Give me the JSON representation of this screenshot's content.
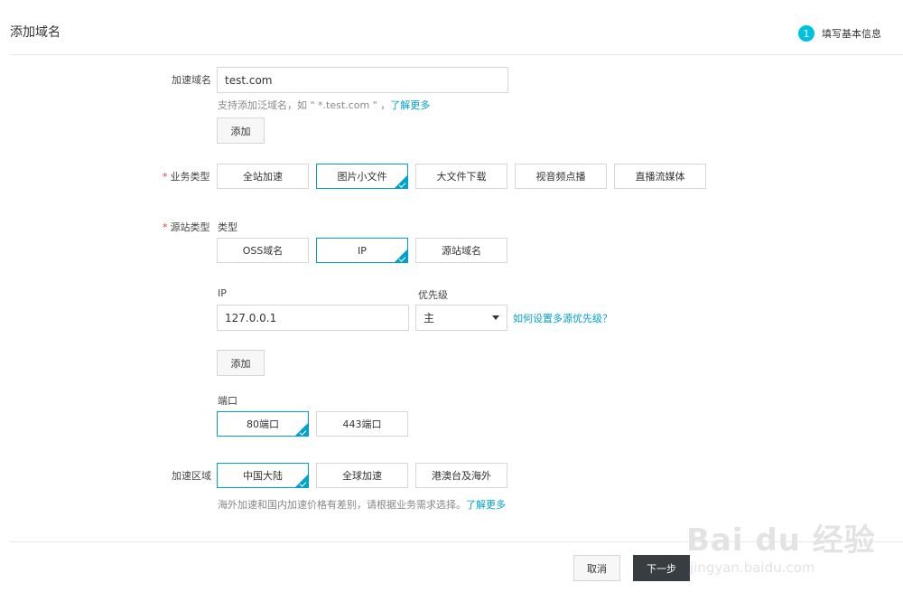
{
  "header": {
    "title": "添加域名",
    "step_number": "1",
    "step_label": "填写基本信息"
  },
  "domain": {
    "label": "加速域名",
    "value": "test.com",
    "hint": "支持添加泛域名，如 \" *.test.com \" ，",
    "hint_link": "了解更多",
    "add_button": "添加"
  },
  "business_type": {
    "label": "业务类型",
    "options": [
      "全站加速",
      "图片小文件",
      "大文件下载",
      "视音频点播",
      "直播流媒体"
    ],
    "selected": "图片小文件"
  },
  "origin": {
    "label": "源站类型",
    "type_label": "类型",
    "types": [
      "OSS域名",
      "IP",
      "源站域名"
    ],
    "selected_type": "IP",
    "ip_label": "IP",
    "ip_value": "127.0.0.1",
    "priority_label": "优先级",
    "priority_value": "主",
    "priority_help": "如何设置多源优先级？",
    "add_button": "添加",
    "port_label": "端口",
    "ports": [
      "80端口",
      "443端口"
    ],
    "selected_port": "80端口"
  },
  "region": {
    "label": "加速区域",
    "options": [
      "中国大陆",
      "全球加速",
      "港澳台及海外"
    ],
    "selected": "中国大陆",
    "hint": "海外加速和国内加速价格有差别，请根据业务需求选择。",
    "hint_link": "了解更多"
  },
  "footer": {
    "cancel": "取消",
    "next": "下一步"
  },
  "watermark": {
    "brand": "Bai du 经验",
    "url": "jingyan.baidu.com"
  }
}
